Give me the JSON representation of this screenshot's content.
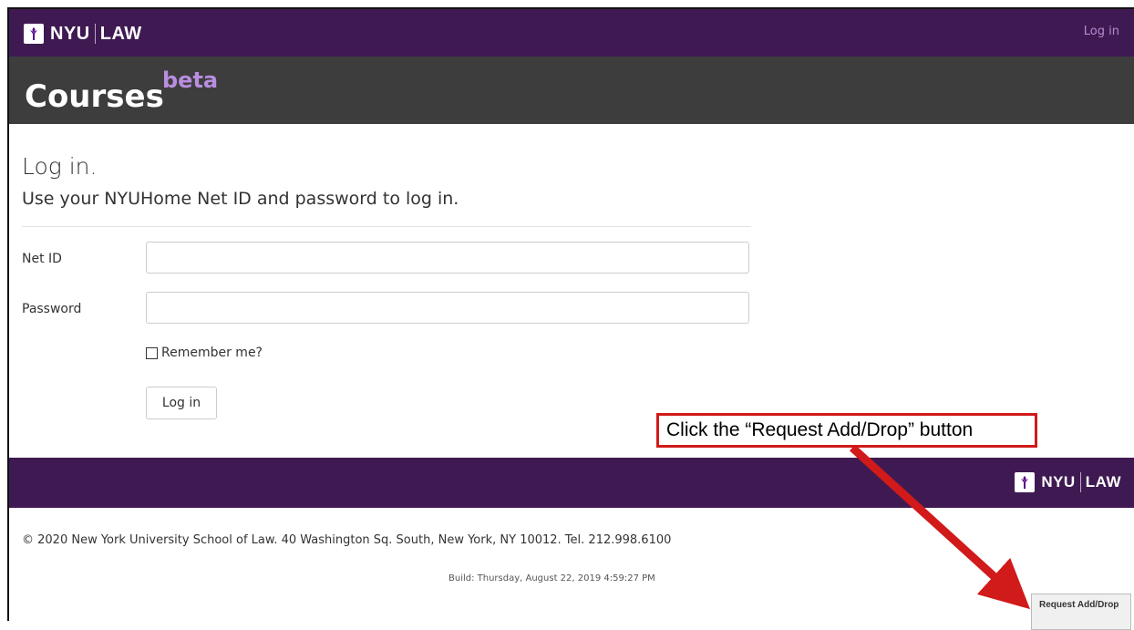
{
  "nav": {
    "logo_left": "NYU",
    "logo_right": "LAW",
    "login_link": "Log in"
  },
  "header": {
    "title": "Courses",
    "badge": "beta"
  },
  "form": {
    "heading": "Log in.",
    "subheading": "Use your NYUHome Net ID and password to log in.",
    "netid_label": "Net ID",
    "netid_value": "",
    "password_label": "Password",
    "password_value": "",
    "remember_label": "Remember me?",
    "remember_checked": false,
    "submit_label": "Log in"
  },
  "footer": {
    "logo_left": "NYU",
    "logo_right": "LAW",
    "copyright": "© 2020 New York University School of Law. 40 Washington Sq. South, New York, NY 10012. Tel. 212.998.6100",
    "build": "Build: Thursday, August 22, 2019 4:59:27 PM"
  },
  "annotation": {
    "callout_text": "Click the “Request Add/Drop” button",
    "callout_color": "#d11a1a"
  },
  "request_button": {
    "label": "Request Add/Drop"
  },
  "colors": {
    "brand_purple": "#3f1a52",
    "header_gray": "#3d3d3d",
    "beta_purple": "#b98de0"
  }
}
